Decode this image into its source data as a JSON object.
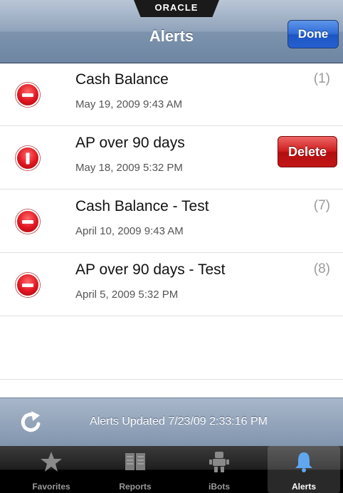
{
  "header": {
    "brand": "ORACLE",
    "title": "Alerts",
    "done_label": "Done"
  },
  "alerts": [
    {
      "title": "Cash Balance",
      "date": "May 19, 2009 9:43 AM",
      "count": "(1)"
    },
    {
      "title": "AP over 90 days",
      "date": "May 18, 2009 5:32 PM",
      "count": "",
      "delete_label": "Delete"
    },
    {
      "title": "Cash Balance - Test",
      "date": "April 10, 2009 9:43 AM",
      "count": "(7)"
    },
    {
      "title": "AP over 90 days - Test",
      "date": "April 5, 2009 5:32 PM",
      "count": "(8)"
    }
  ],
  "status": {
    "text": "Alerts Updated 7/23/09 2:33:16 PM",
    "icon": "refresh-icon"
  },
  "tabs": [
    {
      "label": "Favorites",
      "icon": "star-icon",
      "active": false
    },
    {
      "label": "Reports",
      "icon": "book-icon",
      "active": false
    },
    {
      "label": "iBots",
      "icon": "robot-icon",
      "active": false
    },
    {
      "label": "Alerts",
      "icon": "bell-icon",
      "active": true
    }
  ],
  "colors": {
    "delete_red": "#c21616",
    "done_blue": "#2560d0",
    "nav_blue": "#7d93ad"
  }
}
